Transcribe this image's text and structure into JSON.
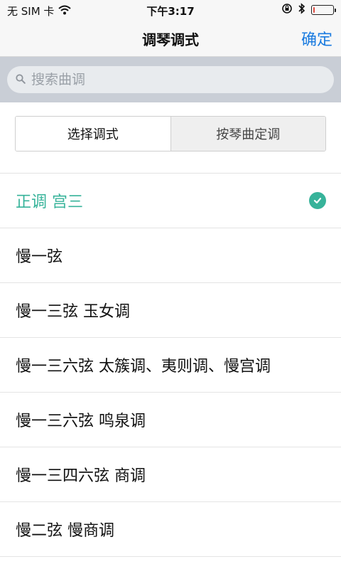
{
  "status_bar": {
    "carrier": "无 SIM 卡",
    "time": "下午3:17",
    "battery_level": 0.08,
    "battery_color": "#e0493f"
  },
  "nav": {
    "title": "调琴调式",
    "confirm_label": "确定",
    "accent_color": "#1a7be0"
  },
  "search": {
    "placeholder": "搜索曲调",
    "value": ""
  },
  "segments": [
    {
      "label": "选择调式",
      "active": true
    },
    {
      "label": "按琴曲定调",
      "active": false
    }
  ],
  "list": {
    "selected_color": "#37b39a",
    "items": [
      {
        "label": "正调 宫三",
        "selected": true
      },
      {
        "label": "慢一弦",
        "selected": false
      },
      {
        "label": "慢一三弦 玉女调",
        "selected": false
      },
      {
        "label": "慢一三六弦 太簇调、夷则调、慢宫调",
        "selected": false
      },
      {
        "label": "慢一三六弦 鸣泉调",
        "selected": false
      },
      {
        "label": "慢一三四六弦 商调",
        "selected": false
      },
      {
        "label": "慢二弦 慢商调",
        "selected": false
      }
    ]
  }
}
